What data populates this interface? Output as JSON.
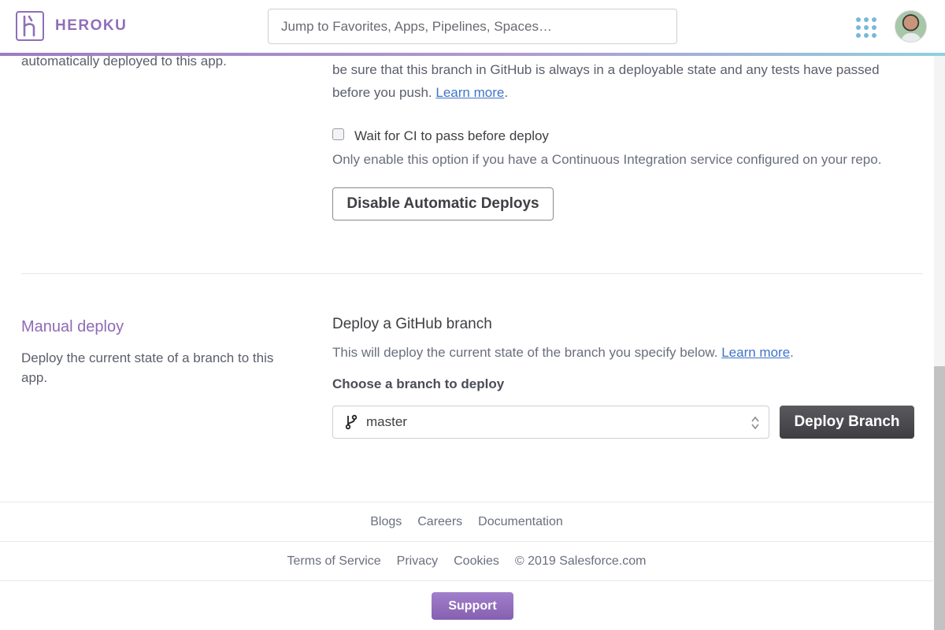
{
  "header": {
    "logo_text": "HEROKU",
    "logo_letter": "H",
    "search_placeholder": "Jump to Favorites, Apps, Pipelines, Spaces…",
    "accent_color": "#8f6fb8"
  },
  "auto_deploy": {
    "left_desc_tail": "automatically deployed to this app.",
    "right_desc_line1": "be sure that this branch in GitHub is always in a deployable state and any tests have passed",
    "right_desc_line2": "before you push.",
    "learn_more": "Learn more",
    "period": ".",
    "ci_checkbox_label": "Wait for CI to pass before deploy",
    "ci_checked": false,
    "ci_hint": "Only enable this option if you have a Continuous Integration service configured on your repo.",
    "disable_button": "Disable Automatic Deploys"
  },
  "manual_deploy": {
    "title": "Manual deploy",
    "description": "Deploy the current state of a branch to this app.",
    "sub_title": "Deploy a GitHub branch",
    "sub_desc": "This will deploy the current state of the branch you specify below.",
    "learn_more": "Learn more",
    "period": ".",
    "choose_label": "Choose a branch to deploy",
    "branch_value": "master",
    "branch_icon": "git-branch-icon",
    "deploy_button": "Deploy Branch"
  },
  "footer": {
    "links_row1": [
      "Blogs",
      "Careers",
      "Documentation"
    ],
    "links_row2": [
      "Terms of Service",
      "Privacy",
      "Cookies"
    ],
    "copyright": "© 2019 Salesforce.com",
    "support_button": "Support"
  }
}
